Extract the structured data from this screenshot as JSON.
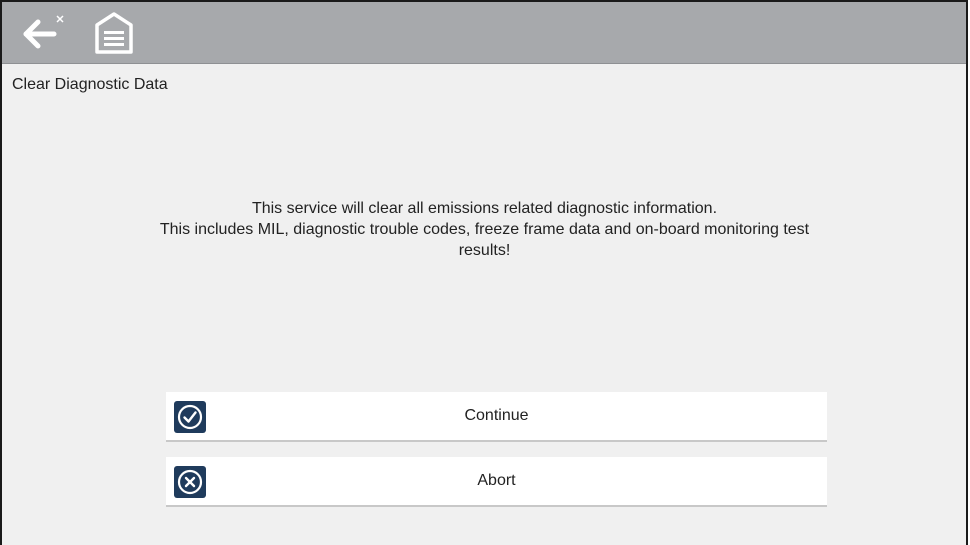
{
  "header": {
    "back_icon": "back-arrow-icon",
    "home_icon": "garage-home-icon"
  },
  "page": {
    "title": "Clear Diagnostic Data"
  },
  "message": {
    "line1": "This service will clear all emissions related diagnostic information.",
    "line2": "This includes MIL, diagnostic trouble codes, freeze frame data and on-board monitoring test",
    "line3": "results!"
  },
  "actions": {
    "continue_label": "Continue",
    "continue_icon": "check-circle-icon",
    "abort_label": "Abort",
    "abort_icon": "x-circle-icon"
  },
  "colors": {
    "topbar": "#a7a9ac",
    "background": "#f0f0f0",
    "icon_bg": "#1f3b5c"
  }
}
